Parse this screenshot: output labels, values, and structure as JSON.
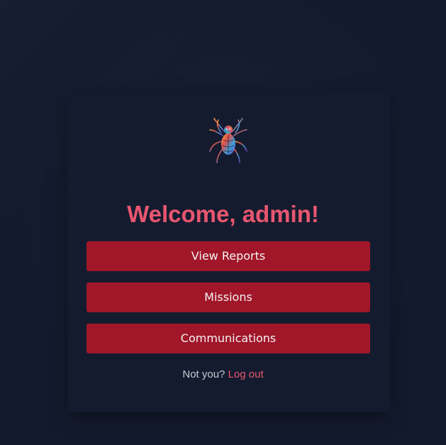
{
  "logo": {
    "icon": "spider-icon"
  },
  "welcome": {
    "title": "Welcome, admin!"
  },
  "actions": {
    "view_reports": "View Reports",
    "missions": "Missions",
    "communications": "Communications"
  },
  "footer": {
    "prompt": "Not you?",
    "logout_label": "Log out"
  },
  "colors": {
    "background": "#141a2e",
    "accent": "#e8566f",
    "button": "#a11629"
  }
}
